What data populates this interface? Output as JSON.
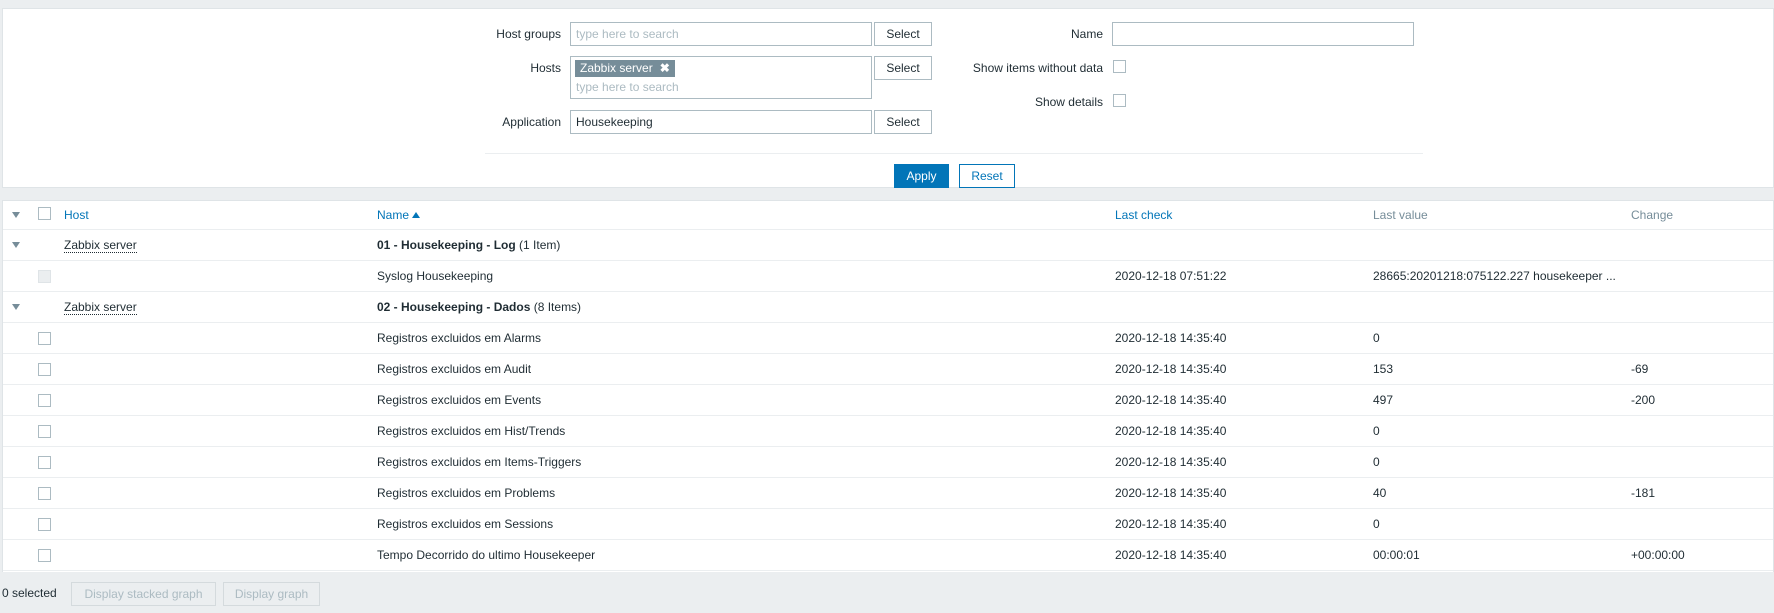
{
  "filter": {
    "host_groups": {
      "label": "Host groups",
      "placeholder": "type here to search",
      "select": "Select"
    },
    "hosts": {
      "label": "Hosts",
      "tag": "Zabbix server",
      "tag_remove": "✖",
      "placeholder": "type here to search",
      "select": "Select"
    },
    "application": {
      "label": "Application",
      "value": "Housekeeping",
      "select": "Select"
    },
    "name": {
      "label": "Name",
      "value": ""
    },
    "show_items_without_data": {
      "label": "Show items without data",
      "checked": false
    },
    "show_details": {
      "label": "Show details",
      "checked": false
    },
    "apply": "Apply",
    "reset": "Reset"
  },
  "table": {
    "columns": {
      "host": "Host",
      "name": "Name",
      "last_check": "Last check",
      "last_value": "Last value",
      "change": "Change"
    },
    "groups": [
      {
        "host": "Zabbix server",
        "name": "01 - Housekeeping - Log",
        "count": "(1 Item)",
        "items": [
          {
            "name": "Syslog Housekeeping",
            "last_check": "2020-12-18 07:51:22",
            "last_value": "28665:20201218:075122.227 housekeeper ...",
            "change": "",
            "disabled": true
          }
        ]
      },
      {
        "host": "Zabbix server",
        "name": "02 - Housekeeping - Dados",
        "count": "(8 Items)",
        "items": [
          {
            "name": "Registros excluidos em Alarms",
            "last_check": "2020-12-18 14:35:40",
            "last_value": "0",
            "change": ""
          },
          {
            "name": "Registros excluidos em Audit",
            "last_check": "2020-12-18 14:35:40",
            "last_value": "153",
            "change": "-69"
          },
          {
            "name": "Registros excluidos em Events",
            "last_check": "2020-12-18 14:35:40",
            "last_value": "497",
            "change": "-200"
          },
          {
            "name": "Registros excluidos em Hist/Trends",
            "last_check": "2020-12-18 14:35:40",
            "last_value": "0",
            "change": ""
          },
          {
            "name": "Registros excluidos em Items-Triggers",
            "last_check": "2020-12-18 14:35:40",
            "last_value": "0",
            "change": ""
          },
          {
            "name": "Registros excluidos em Problems",
            "last_check": "2020-12-18 14:35:40",
            "last_value": "40",
            "change": "-181"
          },
          {
            "name": "Registros excluidos em Sessions",
            "last_check": "2020-12-18 14:35:40",
            "last_value": "0",
            "change": ""
          },
          {
            "name": "Tempo Decorrido do ultimo Housekeeper",
            "last_check": "2020-12-18 14:35:40",
            "last_value": "00:00:01",
            "change": "+00:00:00"
          }
        ]
      }
    ]
  },
  "footer": {
    "selected": "0 selected",
    "stacked_graph": "Display stacked graph",
    "graph": "Display graph"
  }
}
